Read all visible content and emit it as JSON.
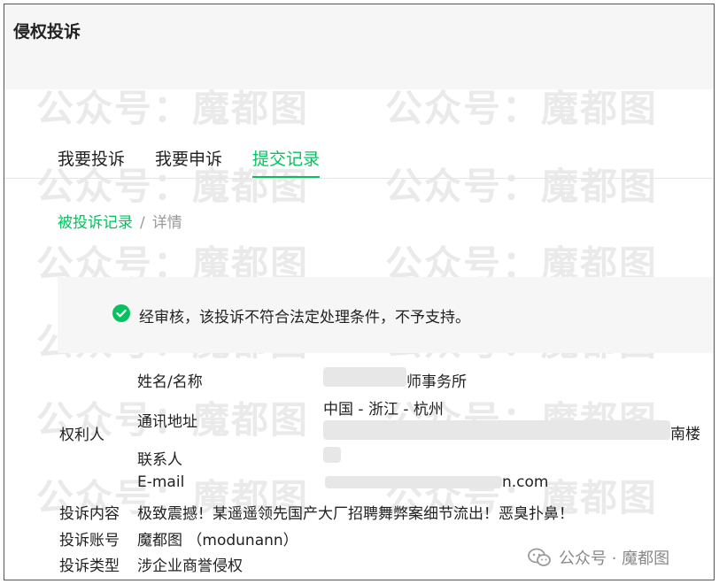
{
  "watermarks": [
    "公众号：魔都图",
    "公众号：魔都图",
    "公众号：魔都图",
    "公众号：魔都图",
    "公众号：魔都图",
    "公众号：魔都图",
    "公众号：魔都图",
    "公众号：魔都图",
    "公众号：魔都图",
    "公众号：魔都图",
    "公众号：魔都图",
    "公众号：魔都图",
    "公众号：魔都图",
    "公众号：魔都图"
  ],
  "header": {
    "title": "侵权投诉"
  },
  "tabs": [
    {
      "label": "我要投诉"
    },
    {
      "label": "我要申诉"
    },
    {
      "label": "提交记录",
      "active": true
    }
  ],
  "breadcrumb": {
    "link": "被投诉记录",
    "separator": "/",
    "current": "详情"
  },
  "notice": {
    "message": "经审核，该投诉不符合法定处理条件，不予支持。"
  },
  "details": {
    "rights_holder_label": "权利人",
    "name_label": "姓名/名称",
    "name_value_suffix": "师事务所",
    "address_label": "通讯地址",
    "address_region": "中国 - 浙江 - 杭州",
    "address_suffix": "南楼",
    "contact_label": "联系人",
    "email_label": "E-mail",
    "email_suffix": "n.com",
    "content_label": "投诉内容",
    "content_value": "极致震撼！某遥遥领先国产大厂招聘舞弊案细节流出！恶臭扑鼻！",
    "account_label": "投诉账号",
    "account_value": "魔都图 （modunann）",
    "type_label": "投诉类型",
    "type_value": "涉企业商誉侵权"
  },
  "brand": {
    "text": "公众号 · 魔都图"
  },
  "colors": {
    "accent": "#07c160",
    "muted": "#999999",
    "panel": "#f6f6f6"
  }
}
